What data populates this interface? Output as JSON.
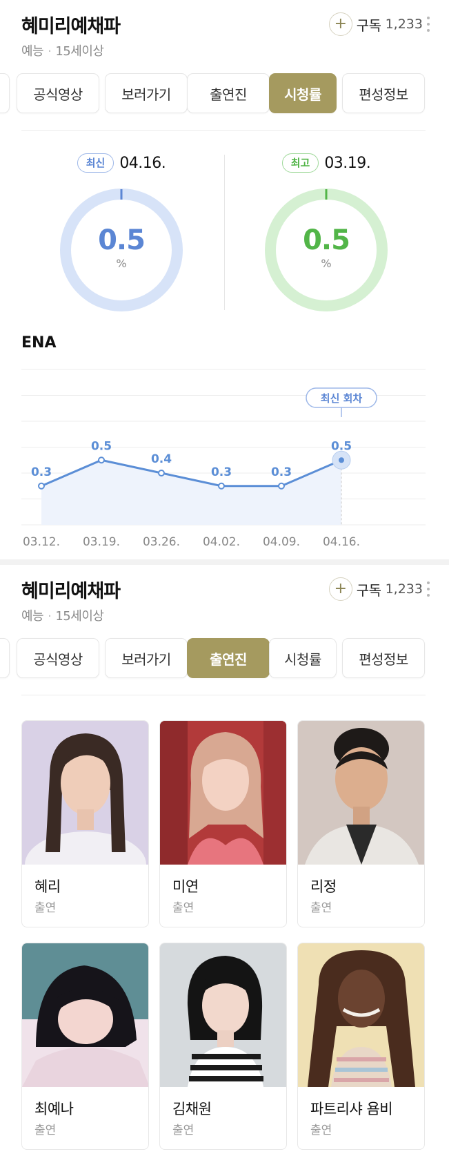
{
  "show": {
    "title": "혜미리예채파",
    "genre": "예능",
    "rating": "15세이상",
    "subscribe_label": "구독",
    "subscribe_count": "1,233"
  },
  "tabs": [
    "공식영상",
    "보러가기",
    "출연진",
    "시청률",
    "편성정보"
  ],
  "panel1_active_tab": "시청률",
  "panel2_active_tab": "출연진",
  "ratings": {
    "latest": {
      "badge": "최신",
      "date": "04.16.",
      "value": "0.5",
      "unit": "%",
      "color": "#5b86d4",
      "ring_color": "#d7e3f8"
    },
    "best": {
      "badge": "최고",
      "date": "03.19.",
      "value": "0.5",
      "unit": "%",
      "color": "#52b548",
      "ring_color": "#d5f0d2"
    }
  },
  "chart_title": "ENA",
  "chart_data": {
    "type": "area",
    "title": "ENA",
    "categories": [
      "03.12.",
      "03.19.",
      "03.26.",
      "04.02.",
      "04.09.",
      "04.16."
    ],
    "values": [
      0.3,
      0.5,
      0.4,
      0.3,
      0.3,
      0.5
    ],
    "value_labels": [
      "0.3",
      "0.5",
      "0.4",
      "0.3",
      "0.3",
      "0.5"
    ],
    "annotation": "최신 회차",
    "annotation_index": 5,
    "ylim": [
      0,
      1.2
    ],
    "grid": true,
    "line_color": "#5b8ed6",
    "fill_color": "#eef3fc"
  },
  "cast_role": "출연",
  "cast": [
    {
      "name": "혜리",
      "role": "출연",
      "photo": "photo-hyeri"
    },
    {
      "name": "미연",
      "role": "출연",
      "photo": "photo-miyeon"
    },
    {
      "name": "리정",
      "role": "출연",
      "photo": "photo-lijung"
    },
    {
      "name": "최예나",
      "role": "출연",
      "photo": "photo-choiyena"
    },
    {
      "name": "김채원",
      "role": "출연",
      "photo": "photo-kimchaewon"
    },
    {
      "name": "파트리샤 욤비",
      "role": "출연",
      "photo": "photo-patricia"
    }
  ]
}
